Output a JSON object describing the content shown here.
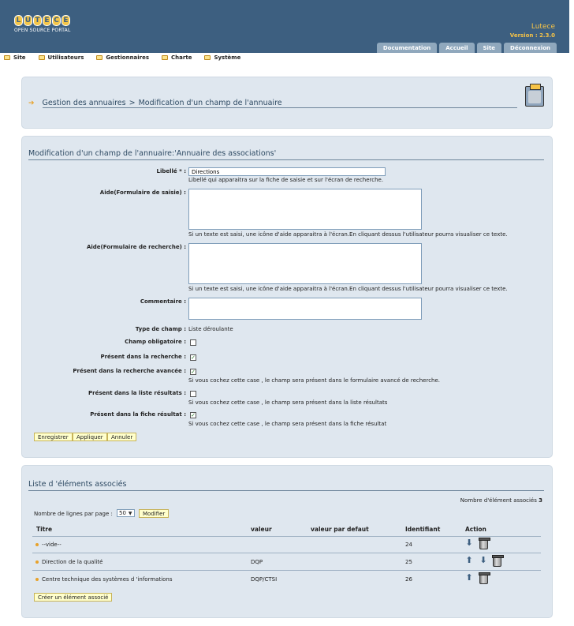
{
  "header": {
    "logo_letters": [
      "L",
      "U",
      "T",
      "E",
      "C",
      "E"
    ],
    "logo_subtitle": "OPEN SOURCE PORTAL",
    "brand_name": "Lutece",
    "version": "Version : 2.3.0",
    "tabs": [
      "Documentation",
      "Accueil",
      "Site",
      "Déconnexion"
    ],
    "colors": {
      "header_bg": "#3d5f80",
      "brand": "#f6c347",
      "tab_bg": "#90a8bd"
    }
  },
  "menu": {
    "items": [
      "Site",
      "Utilisateurs",
      "Gestionnaires",
      "Charte",
      "Système"
    ]
  },
  "breadcrumb": {
    "parent": "Gestion des annuaires",
    "separator": ">",
    "current": "Modification d'un champ de l'annuaire"
  },
  "form": {
    "title": "Modification d'un champ de l'annuaire:'Annuaire des associations'",
    "libelle_label": "Libellé * :",
    "libelle_value": "Directions",
    "libelle_help": "Libellé qui apparaitra sur la fiche de saisie et sur l'écran de recherche.",
    "aide_saisie_label": "Aide(Formulaire de saisie) :",
    "aide_saisie_help": "Si un texte est saisi, une icône d'aide apparaitra à l'écran.En cliquant dessus l'utilisateur pourra visualiser ce texte.",
    "aide_recherche_label": "Aide(Formulaire de recherche) :",
    "aide_recherche_help": "Si un texte est saisi, une icône d'aide apparaitra à l'écran.En cliquant dessus l'utilisateur pourra visualiser ce texte.",
    "commentaire_label": "Commentaire :",
    "type_label": "Type de champ :",
    "type_value": "Liste déroulante",
    "obligatoire_label": "Champ obligatoire :",
    "obligatoire_checked": false,
    "recherche_label": "Présent dans la recherche :",
    "recherche_checked": true,
    "recherche_avancee_label": "Présent dans la recherche avancée :",
    "recherche_avancee_checked": true,
    "recherche_avancee_help": "Si vous cochez cette case , le champ sera présent dans le formulaire avancé de recherche.",
    "liste_label": "Présent dans la liste résultats :",
    "liste_checked": false,
    "liste_help": "Si vous cochez cette case , le champ sera présent dans la liste résultats",
    "fiche_label": "Présent dans la fiche résultat :",
    "fiche_checked": true,
    "fiche_help": "Si vous cochez cette case , le champ sera présent dans la fiche résultat",
    "buttons": {
      "save": "Enregistrer",
      "apply": "Appliquer",
      "cancel": "Annuler"
    }
  },
  "list": {
    "title": "Liste d 'éléments associés",
    "count_label": "Nombre d'élément associés",
    "count_value": "3",
    "rows_per_page_label": "Nombre de lignes par page :",
    "rows_per_page_value": "50",
    "modify_button": "Modifier",
    "headers": [
      "Titre",
      "valeur",
      "valeur par defaut",
      "Identifiant",
      "Action"
    ],
    "rows": [
      {
        "titre": "--vide--",
        "valeur": "",
        "defaut": "",
        "id": "24",
        "actions": [
          "arrow-down-icon",
          "trash-icon"
        ]
      },
      {
        "titre": "Direction de la qualité",
        "valeur": "DQP",
        "defaut": "",
        "id": "25",
        "actions": [
          "arrow-up-icon",
          "arrow-down-icon",
          "trash-icon"
        ]
      },
      {
        "titre": "Centre technique des systèmes d 'informations",
        "valeur": "DQP/CTSI",
        "defaut": "",
        "id": "26",
        "actions": [
          "arrow-up-icon",
          "trash-icon"
        ]
      }
    ],
    "create_button": "Créer un élément associé"
  }
}
